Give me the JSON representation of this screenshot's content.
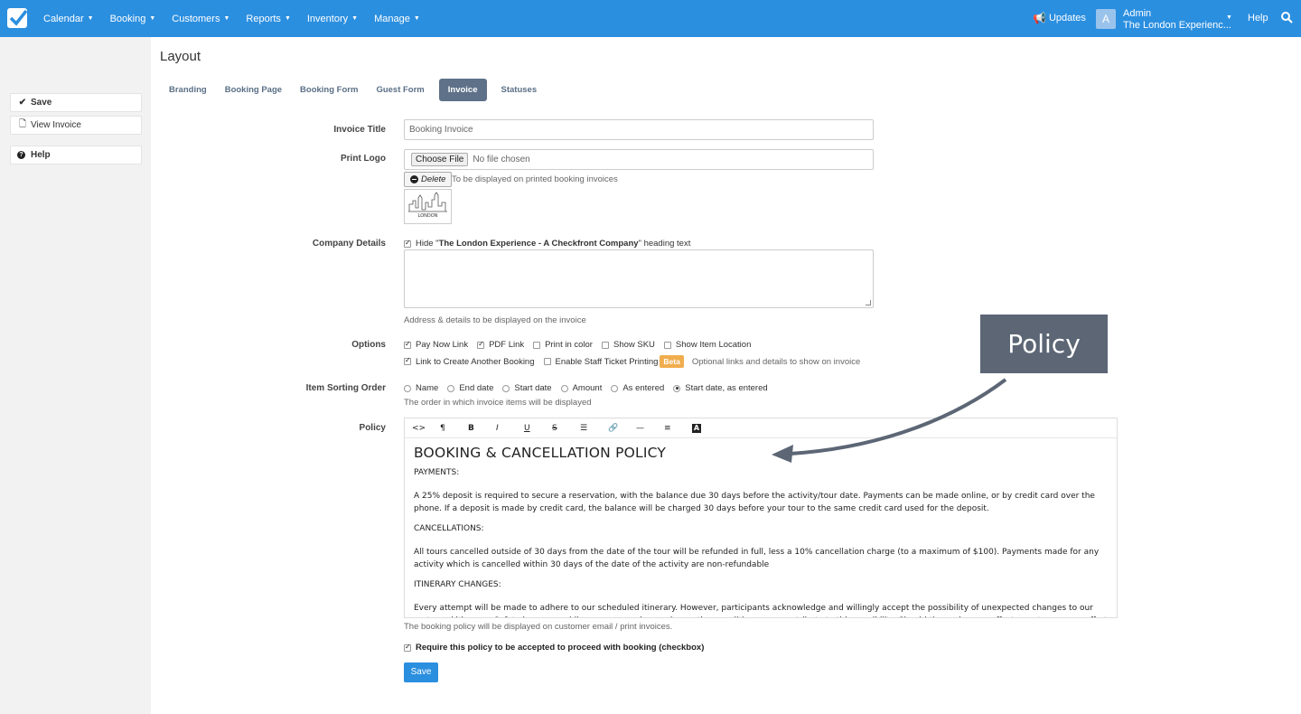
{
  "topbar": {
    "nav": [
      "Calendar",
      "Booking",
      "Customers",
      "Reports",
      "Inventory",
      "Manage"
    ],
    "updates": "Updates",
    "avatar_letter": "A",
    "user_name": "Admin",
    "user_company": "The London Experienc...",
    "help": "Help",
    "brand_color": "#2b8fe0"
  },
  "sidebar": {
    "save": "Save",
    "view_invoice": "View Invoice",
    "help": "Help"
  },
  "page": {
    "title": "Layout",
    "tabs": [
      "Branding",
      "Booking Page",
      "Booking Form",
      "Guest Form",
      "Invoice",
      "Statuses"
    ],
    "active_tab": "Invoice"
  },
  "form": {
    "invoice_title_label": "Invoice Title",
    "invoice_title_value": "Booking Invoice",
    "print_logo_label": "Print Logo",
    "choose_file": "Choose File",
    "no_file": "No file chosen",
    "delete": "Delete",
    "logo_hint": "To be displayed on printed booking invoices",
    "logo_text": "LONDON",
    "company_details_label": "Company Details",
    "hide_prefix": "Hide \"",
    "hide_company": "The London Experience - A Checkfront Company",
    "hide_suffix": "\" heading text",
    "company_hint": "Address & details to be displayed on the invoice",
    "options_label": "Options",
    "options_row1": [
      {
        "label": "Pay Now Link",
        "checked": true
      },
      {
        "label": "PDF Link",
        "checked": true
      },
      {
        "label": "Print in color",
        "checked": false
      },
      {
        "label": "Show SKU",
        "checked": false
      },
      {
        "label": "Show Item Location",
        "checked": false
      }
    ],
    "options_row2": [
      {
        "label": "Link to Create Another Booking",
        "checked": true
      },
      {
        "label": "Enable Staff Ticket Printing",
        "checked": false
      }
    ],
    "beta": "Beta",
    "options_hint": "Optional links and details to show on invoice",
    "sorting_label": "Item Sorting Order",
    "sorting": [
      {
        "label": "Name",
        "checked": false
      },
      {
        "label": "End date",
        "checked": false
      },
      {
        "label": "Start date",
        "checked": false
      },
      {
        "label": "Amount",
        "checked": false
      },
      {
        "label": "As entered",
        "checked": false
      },
      {
        "label": "Start date, as entered",
        "checked": true
      }
    ],
    "sorting_hint": "The order in which invoice items will be displayed",
    "policy_label": "Policy",
    "policy": {
      "heading": "BOOKING & CANCELLATION POLICY",
      "payments_heading": "PAYMENTS:",
      "payments_text": "A 25% deposit is required to secure a reservation, with the balance due 30 days before the activity/tour date. Payments can be made online, or by credit card over the phone. If a deposit is made by credit card, the balance will be charged 30 days before your tour to the same credit card used for the deposit.",
      "cancellations_heading": "CANCELLATIONS:",
      "cancellations_text": "All tours cancelled outside of 30 days from the date of the tour will be refunded in full, less a 10% cancellation charge (to a maximum of $100). Payments made for any activity which is cancelled within 30 days of the date of the activity are non-refundable",
      "itinerary_heading": "ITINERARY CHANGES:",
      "itinerary_text": "Every attempt will be made to adhere to our scheduled itinerary. However, participants acknowledge and willingly accept the possibility of unexpected changes to our route and itinerary. Safety is our overriding concern and as such, weather conditions may contribute to this possibility. Should these changes affect your tour, every effort"
    },
    "policy_hint": "The booking policy will be displayed on customer email / print invoices.",
    "require_policy": "Require this policy to be accepted to proceed with booking (checkbox)",
    "save": "Save"
  },
  "callout": {
    "text": "Policy",
    "color": "#5c6675"
  }
}
